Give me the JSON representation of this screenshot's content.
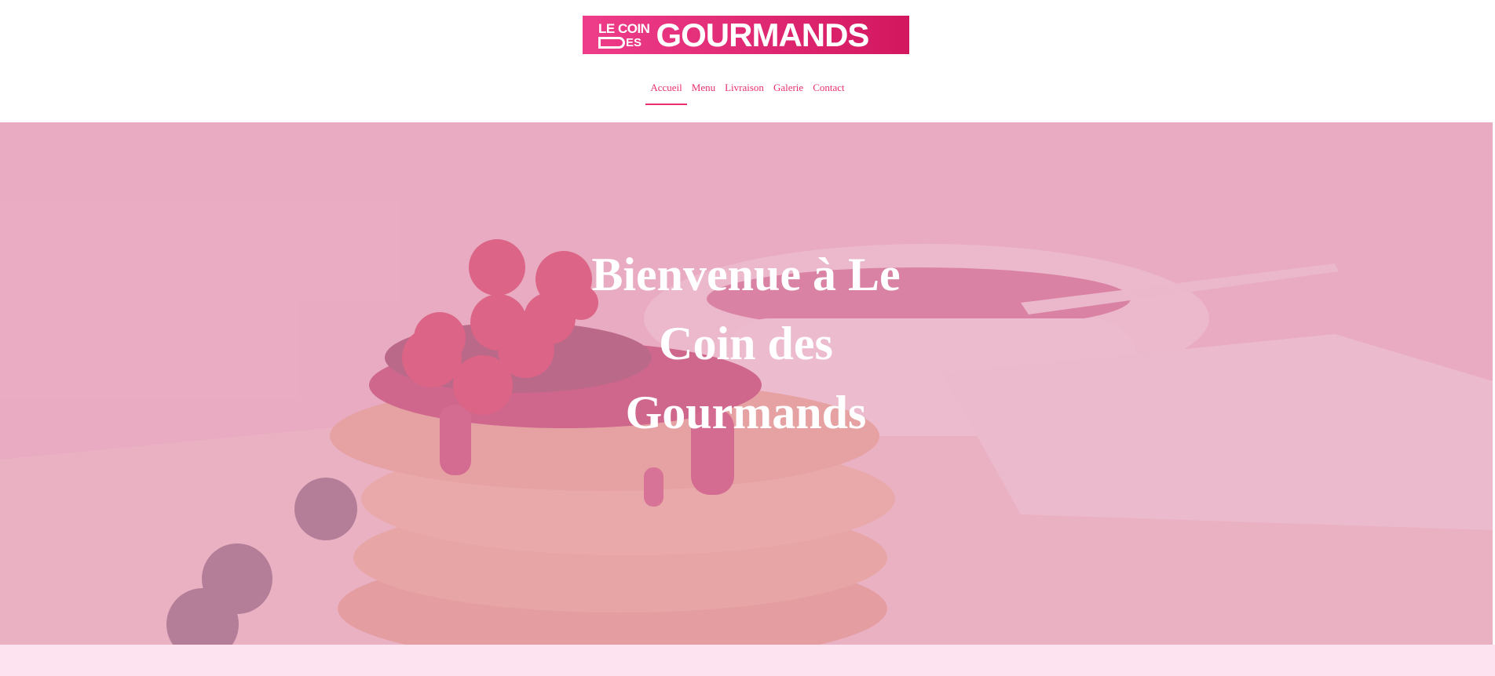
{
  "logo": {
    "line1": "LE COIN",
    "line2": "ES",
    "wordmark": "GOURMANDS",
    "gradient_start": "#ee3d8a",
    "gradient_end": "#d3175f"
  },
  "nav": {
    "items": [
      {
        "label": "Accueil",
        "active": true
      },
      {
        "label": "Menu",
        "active": false
      },
      {
        "label": "Livraison",
        "active": false
      },
      {
        "label": "Galerie",
        "active": false
      },
      {
        "label": "Contact",
        "active": false
      }
    ]
  },
  "hero": {
    "title_line1": "Bienvenue à Le",
    "title_line2": "Coin des",
    "title_line3": "Gourmands",
    "image": "waffles-with-redcurrants-and-berry-jam-photo"
  },
  "colors": {
    "accent": "#e8306f",
    "overlay": "rgba(228, 150, 180, 0.55)",
    "footer_strip": "#fde3ef"
  }
}
